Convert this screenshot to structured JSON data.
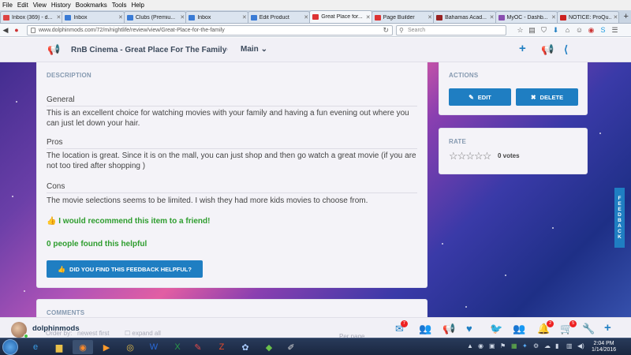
{
  "browser": {
    "menu": [
      "File",
      "Edit",
      "View",
      "History",
      "Bookmarks",
      "Tools",
      "Help"
    ],
    "tabs": [
      {
        "title": "Inbox (369) - d...",
        "color": "#d44"
      },
      {
        "title": "Inbox",
        "color": "#3a7bd5"
      },
      {
        "title": "Clubs (Premiu...",
        "color": "#3a7bd5"
      },
      {
        "title": "Inbox",
        "color": "#3a7bd5"
      },
      {
        "title": "Edit Product",
        "color": "#3a7bd5"
      },
      {
        "title": "Great Place for...",
        "color": "#d33",
        "active": true
      },
      {
        "title": "Page Builder",
        "color": "#d33"
      },
      {
        "title": "Bahamas Acad...",
        "color": "#922"
      },
      {
        "title": "MyOC - Dashb...",
        "color": "#8a4fb0"
      },
      {
        "title": "NOTICE: ProQu...",
        "color": "#c22"
      }
    ],
    "url": "www.dolphinmods.com/72/m/nightlife/review/view/Great-Place-for-the-family",
    "search_placeholder": "Search"
  },
  "header": {
    "title": "RnB Cinema - Great Place For The Family",
    "breadcrumb_menu": "Main"
  },
  "description": {
    "heading": "DESCRIPTION",
    "general_label": "General",
    "general_text": "This is an excellent choice for watching movies with your family and having a fun evening out where you can just let down your hair.",
    "pros_label": "Pros",
    "pros_text": "The location is great. Since it is on the mall, you can just shop and then go watch a great movie (if you are not too tired after shopping )",
    "cons_label": "Cons",
    "cons_text": "The movie selections seems to be limited. I wish they had more kids movies to choose from.",
    "recommend": "I would recommend this item to a friend!",
    "helpful_count": "0 people found this helpful",
    "helpful_button": "DID YOU FIND THIS FEEDBACK HELPFUL?"
  },
  "actions": {
    "heading": "ACTIONS",
    "edit": "EDIT",
    "delete": "DELETE"
  },
  "rate": {
    "heading": "RATE",
    "stars_display": "☆☆☆☆☆",
    "votes": "0 votes"
  },
  "comments": {
    "heading": "COMMENTS",
    "sort_label": "Order by:",
    "sort_value": "newest first",
    "expand_label": "expand all",
    "per_page_label": "Per page"
  },
  "feedback_tab": "FEEDBACK",
  "bottom": {
    "username": "dolphinmods",
    "mail_badge": "7",
    "notif_badge": "2",
    "cart_badge": "5"
  },
  "taskbar": {
    "time": "2:04 PM",
    "date": "1/14/2016"
  },
  "colors": {
    "accent": "#1f7ec2",
    "green": "#2e9d2e",
    "badge": "#e22"
  }
}
